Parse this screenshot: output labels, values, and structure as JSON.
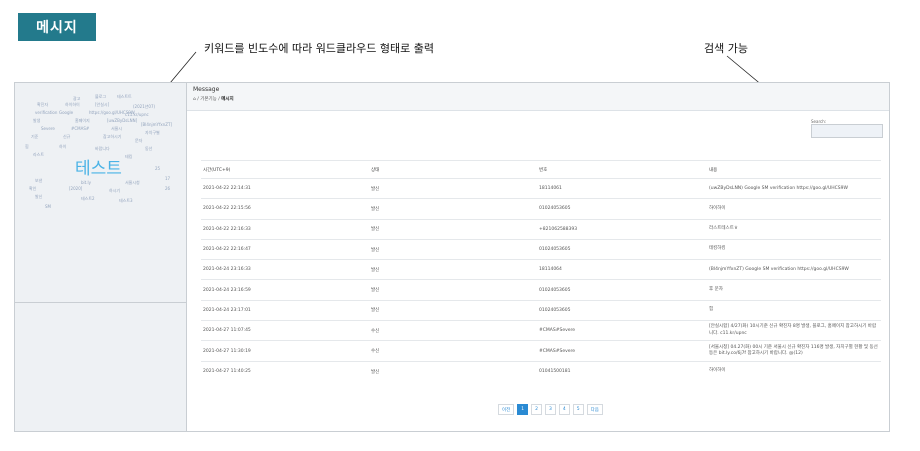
{
  "badge": "메시지",
  "annotations": {
    "wordcloud": "키워드를 빈도수에 따라 워드클라우드 형태로 출력",
    "search": "검색 가능"
  },
  "header": {
    "title": "Message",
    "breadcrumb_parent": "기본기능",
    "breadcrumb_current": "메시지"
  },
  "search": {
    "label": "Search:"
  },
  "table": {
    "headers": [
      "시간(UTC+9)",
      "상태",
      "번호",
      "내용"
    ],
    "rows": [
      [
        "2021-04-22 22:14:31",
        "발신",
        "18114061",
        "(uwZByDsLNN) Google SM verification https://goo.gl/UHCS9W"
      ],
      [
        "2021-04-22 22:15:56",
        "발신",
        "01024053605",
        "하이하이"
      ],
      [
        "2021-04-22 22:16:33",
        "발신",
        "+821062588393",
        "라스트테스트ㅎ"
      ],
      [
        "2021-04-22 22:16:47",
        "발신",
        "01024053605",
        "테킹하킹"
      ],
      [
        "2021-04-24 23:16:33",
        "발신",
        "18114064",
        "(Bl4njmYfxnZT) Google SM verification https://goo.gl/UHCS9W"
      ],
      [
        "2021-04-24 23:16:59",
        "발신",
        "01024053605",
        "후 문자"
      ],
      [
        "2021-04-24 23:17:01",
        "발신",
        "01024053605",
        "힘"
      ],
      [
        "2021-04-27 11:07:45",
        "수신",
        "#CMAS#Severe",
        "[안실시합] 4/27(화) 10시기준 신규 확진자 8명 발생, 블로그, 홈페이지 참고하시기 바랍니다. c11.kr/upnc"
      ],
      [
        "2021-04-27 11:30:19",
        "수신",
        "#CMAS#Severe",
        "[서울시청] 04.27(화) 00시 기준 서울시 신규 확진자 116명 발생, 자치구별 현황 및 동선 등은 bit.ly.co/6j7f 참고하시기 바랍니다. @(12)"
      ],
      [
        "2021-04-27 11:40:25",
        "발신",
        "01041500181",
        "하이하이"
      ]
    ]
  },
  "pagination": {
    "prev": "이전",
    "pages": [
      "1",
      "2",
      "3",
      "4",
      "5"
    ],
    "next": "다음"
  },
  "wordcloud": {
    "main": "테스트",
    "words": [
      "광고",
      "블로그",
      "테스트트",
      "확진자",
      "하이하이",
      "[안실시]",
      "(2021년07)",
      "verification",
      "Google",
      "https://goo.gl/UHCS9W",
      "c11.kr/upnc",
      "발생",
      "홈페이지",
      "[uwZByDsLNN]",
      "[Bl4njmYfxnZT]",
      "Severe",
      "#CMAS#",
      "서울시",
      "자치구별",
      "기준",
      "신규",
      "참고하시기",
      "문자",
      "힘",
      "하이",
      "바랍니다",
      "동선",
      "라스트",
      "테킹",
      "보낸",
      "bit.ly",
      "서울시청",
      "확인",
      "[2020]",
      "하시기",
      "발신",
      "테스트2",
      "테스트3",
      "SM",
      "25",
      "17",
      "26"
    ]
  }
}
